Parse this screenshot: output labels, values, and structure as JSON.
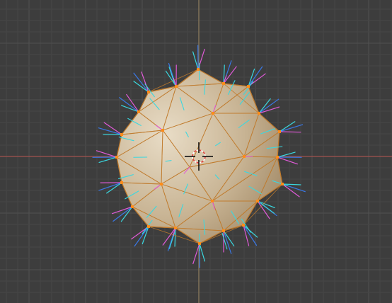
{
  "viewport": {
    "view": "top-orthographic",
    "object": "icosphere",
    "mode": "edit",
    "overlays": [
      "face-normals",
      "vertex-normals",
      "split-normals"
    ]
  },
  "colors": {
    "background": "#3d3d3d",
    "grid_minor": "#464646",
    "grid_major": "#515151",
    "axis_x": "#a2534f",
    "axis_y": "#8a7a5d",
    "mesh_light": "#e8dcc6",
    "mesh_mid": "#c8b494",
    "mesh_dark": "#9c8360",
    "edge": "#c07a2c",
    "vertex": "#ff8c1a",
    "face_normal": "#3ad8e0",
    "vertex_normal": "#3a78e6",
    "split_normal": "#e05ad8",
    "cursor_ring": "#e33d3d",
    "cursor_cross": "#111111"
  }
}
